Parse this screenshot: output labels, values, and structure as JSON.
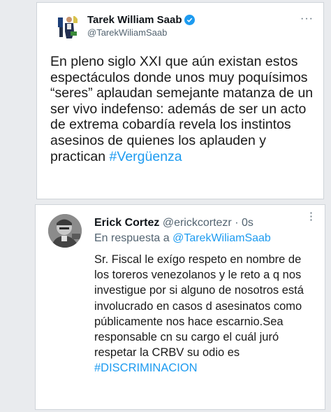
{
  "tweet": {
    "display_name": "Tarek William Saab",
    "handle": "@TarekWiliamSaab",
    "text": "En pleno siglo XXI que aún existan estos espectáculos donde unos muy poquísimos “seres” aplaudan semejante matanza de un ser vivo indefenso: además de ser un acto de extrema cobardía revela los instintos asesinos de quienes los aplauden y practican ",
    "hashtag": "#Vergüenza",
    "more_label": "···"
  },
  "reply": {
    "display_name": "Erick Cortez",
    "handle": "@erickcortezr",
    "separator": " · ",
    "time": "0s",
    "reply_prefix": "En respuesta a ",
    "reply_to": "@TarekWiliamSaab",
    "text": "Sr. Fiscal le exígo respeto en nombre de los toreros venezolanos y le reto a q nos investigue por si alguno de nosotros está involucrado en casos d asesinatos como públicamente nos hace escarnio.Sea responsable cn su cargo el cuál juró respetar la CRBV su odio es ",
    "hashtag": "#DISCRIMINACION",
    "more_label": "⋮"
  },
  "colors": {
    "link": "#1d9bf0",
    "verified": "#1d9bf0",
    "text": "#1a1a1a",
    "muted": "#536471"
  },
  "icons": [
    "verified-badge-icon",
    "more-options-icon",
    "avatar"
  ]
}
